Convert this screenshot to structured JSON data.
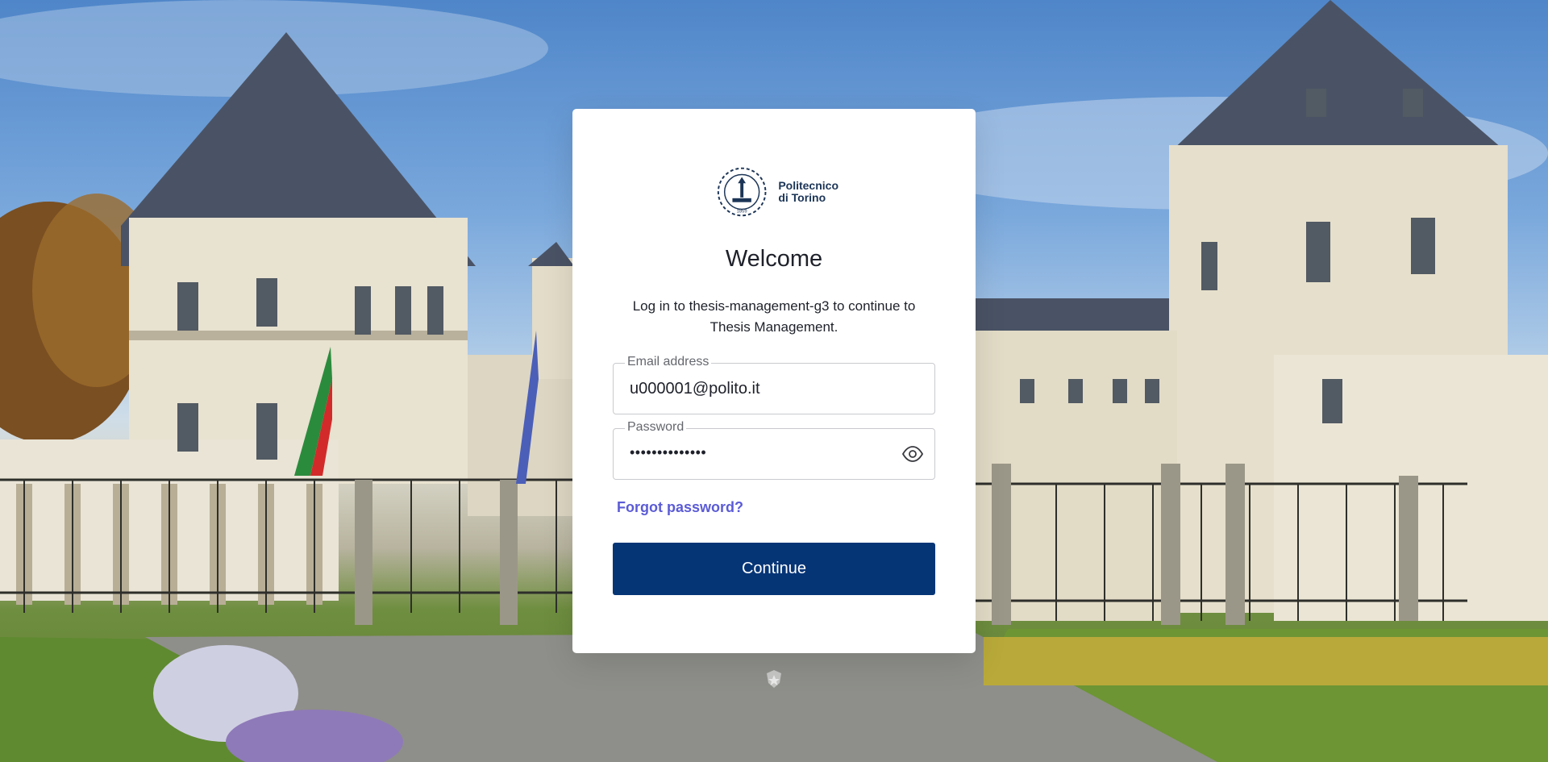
{
  "login": {
    "logo_line1": "Politecnico",
    "logo_line2": "di Torino",
    "logo_year": "1859",
    "title": "Welcome",
    "subtitle": "Log in to thesis-management-g3 to continue to Thesis Management.",
    "email": {
      "label": "Email address",
      "value": "u000001@polito.it"
    },
    "password": {
      "label": "Password",
      "masked_value": "••••••••••••••",
      "toggle_icon": "eye-icon"
    },
    "forgot_password": "Forgot password?",
    "continue_button": "Continue"
  },
  "colors": {
    "primary_button": "#063576",
    "link": "#5b5bd6",
    "logo": "#1c3557"
  }
}
